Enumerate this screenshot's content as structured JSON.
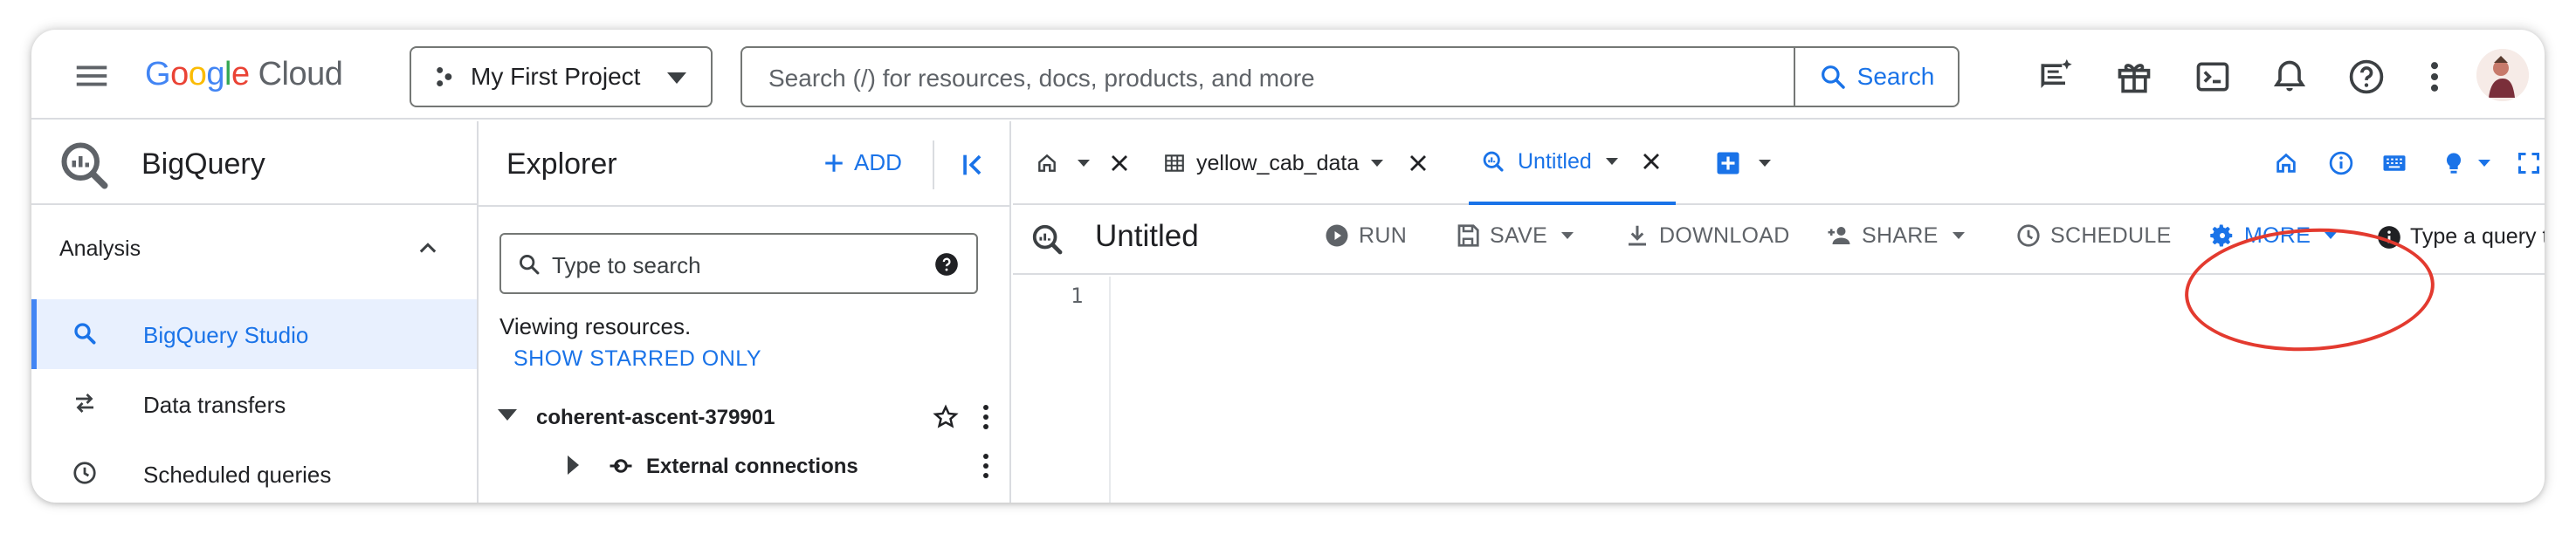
{
  "header": {
    "logo_google": [
      "G",
      "o",
      "o",
      "g",
      "l",
      "e"
    ],
    "logo_cloud": "Cloud",
    "project_label": "My First Project",
    "search_placeholder": "Search (/) for resources, docs, products, and more",
    "search_button_label": "Search"
  },
  "leftnav": {
    "product_title": "BigQuery",
    "section_label": "Analysis",
    "items": [
      {
        "label": "BigQuery Studio",
        "icon": "search-icon",
        "active": true
      },
      {
        "label": "Data transfers",
        "icon": "swap-arrows-icon",
        "active": false
      },
      {
        "label": "Scheduled queries",
        "icon": "clock-icon",
        "active": false
      }
    ]
  },
  "explorer": {
    "title": "Explorer",
    "add_label": "ADD",
    "search_placeholder": "Type to search",
    "viewing_text": "Viewing resources.",
    "starred_link": "SHOW STARRED ONLY",
    "tree": [
      {
        "label": "coherent-ascent-379901",
        "expanded": true
      },
      {
        "label": "External connections",
        "expanded": false
      }
    ]
  },
  "workspace": {
    "tabs": [
      {
        "label": "",
        "icon": "home-icon",
        "active": false
      },
      {
        "label": "yellow_cab_data",
        "icon": "table-icon",
        "active": false
      },
      {
        "label": "Untitled",
        "icon": "query-icon",
        "active": true
      }
    ],
    "query_title": "Untitled",
    "toolbar": {
      "run": "RUN",
      "save": "SAVE",
      "download": "DOWNLOAD",
      "share": "SHARE",
      "schedule": "SCHEDULE",
      "more": "MORE",
      "hint": "Type a query t..."
    },
    "editor": {
      "line_numbers": [
        "1"
      ]
    }
  },
  "colors": {
    "accent": "#1a73e8",
    "annotation": "#e33a2f",
    "active_nav_bg": "#e8f0fe"
  }
}
